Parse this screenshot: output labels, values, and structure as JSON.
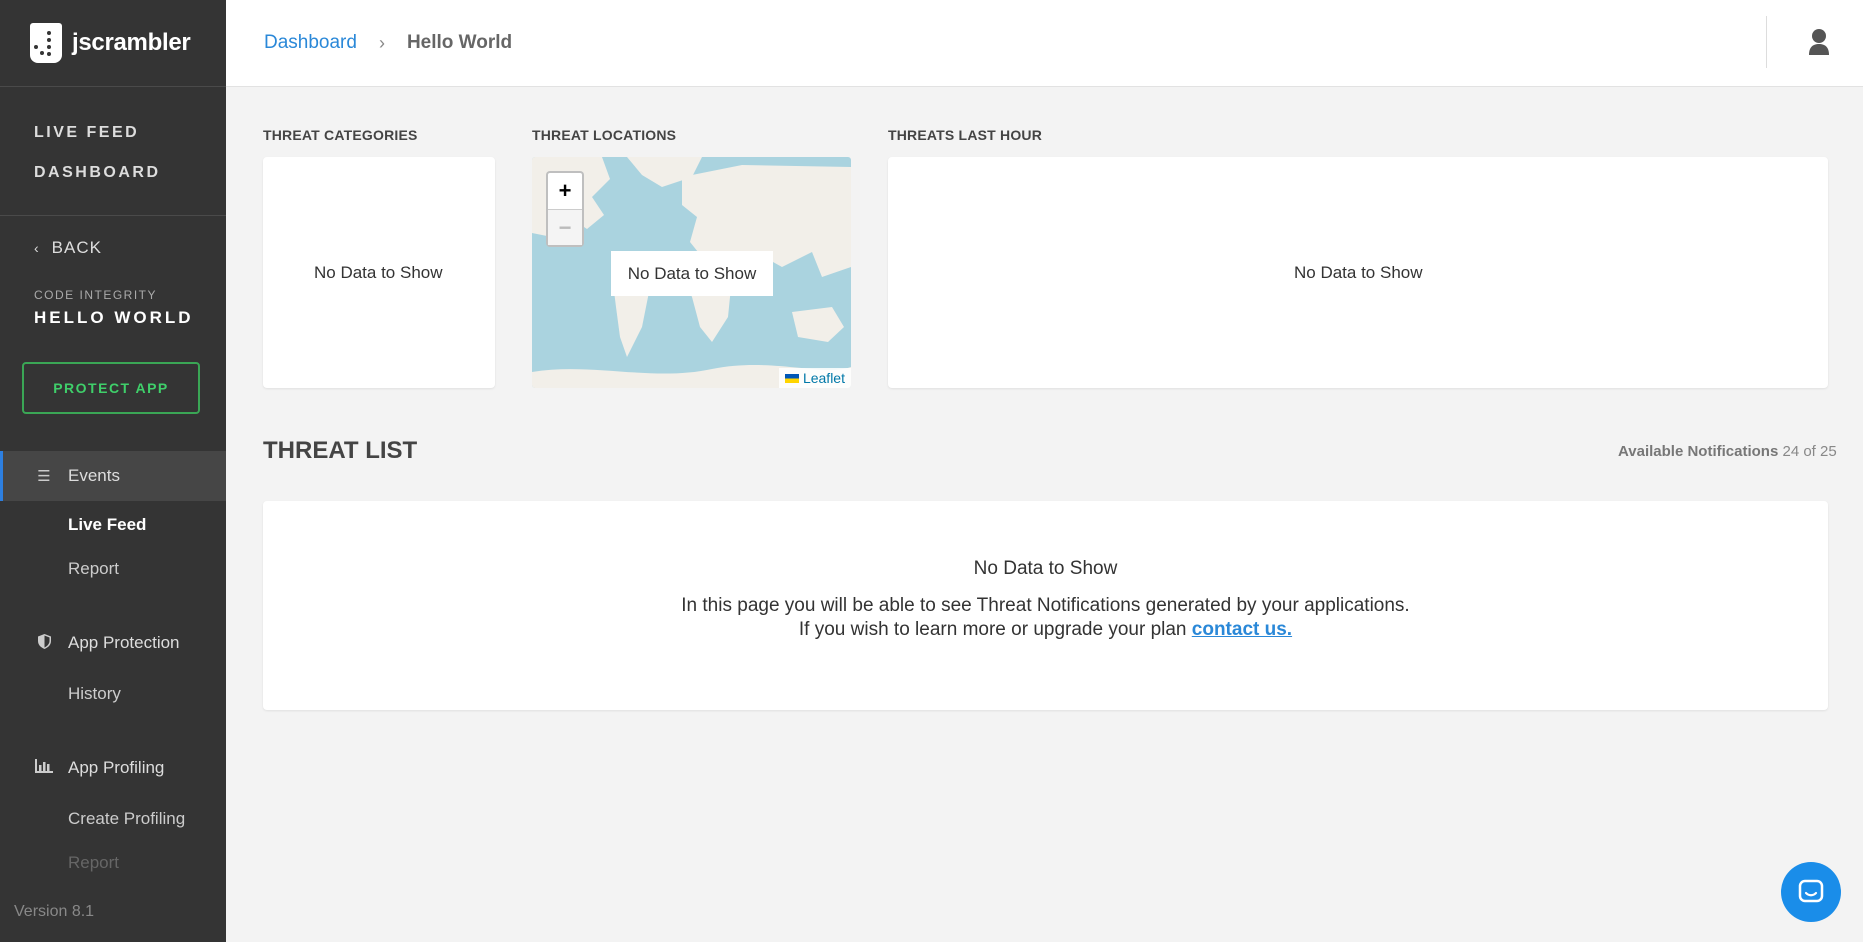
{
  "brand": {
    "name": "jscrambler"
  },
  "sidebar": {
    "top_nav": [
      "LIVE FEED",
      "DASHBOARD"
    ],
    "back_label": "BACK",
    "app_type": "CODE INTEGRITY",
    "app_name": "HELLO WORLD",
    "protect_button": "PROTECT APP",
    "sections": [
      {
        "label": "Events",
        "icon": "list-icon",
        "items": [
          "Live Feed",
          "Report"
        ]
      },
      {
        "label": "App Protection",
        "icon": "shield-icon",
        "items": [
          "History"
        ]
      },
      {
        "label": "App Profiling",
        "icon": "bar-chart-icon",
        "items": [
          "Create Profiling",
          "Report"
        ]
      }
    ],
    "version": "Version 8.1",
    "accent_color": "#2d7fe0",
    "protect_color": "#3fcf6a"
  },
  "header": {
    "breadcrumb": [
      "Dashboard",
      "Hello World"
    ],
    "user_icon": "user-icon"
  },
  "widgets": {
    "categories": {
      "title": "THREAT CATEGORIES",
      "empty": "No Data to Show"
    },
    "locations": {
      "title": "THREAT LOCATIONS",
      "empty": "No Data to Show",
      "attribution": "Leaflet",
      "zoom_in": "+",
      "zoom_out": "−"
    },
    "last_hour": {
      "title": "THREATS LAST HOUR",
      "empty": "No Data to Show"
    }
  },
  "threat_list": {
    "title": "THREAT LIST",
    "available_label": "Available Notifications",
    "available_count": "24 of 25",
    "empty_title": "No Data to Show",
    "line1": "In this page you will be able to see Threat Notifications generated by your applications.",
    "line2": "If you wish to learn more or upgrade your plan",
    "link": "contact us."
  },
  "chat_icon": "chat-icon"
}
